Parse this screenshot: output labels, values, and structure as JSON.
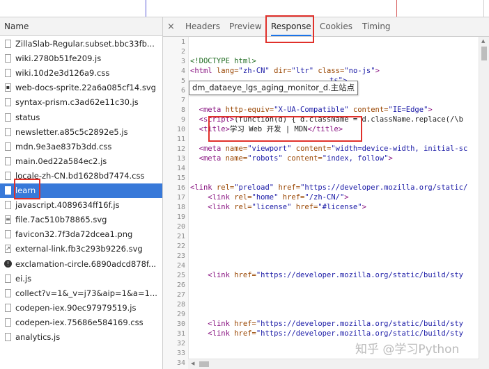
{
  "network": {
    "column_header": "Name",
    "requests": [
      {
        "name": "ZillaSlab-Regular.subset.bbc33fb...",
        "icon": "file-icon"
      },
      {
        "name": "wiki.2780b51fe209.js",
        "icon": "file-icon"
      },
      {
        "name": "wiki.10d2e3d126a9.css",
        "icon": "file-icon"
      },
      {
        "name": "web-docs-sprite.22a6a085cf14.svg",
        "icon": "sprite-icon"
      },
      {
        "name": "syntax-prism.c3ad62e11c30.js",
        "icon": "file-icon"
      },
      {
        "name": "status",
        "icon": "file-icon"
      },
      {
        "name": "newsletter.a85c5c2892e5.js",
        "icon": "file-icon"
      },
      {
        "name": "mdn.9e3ae837b3dd.css",
        "icon": "file-icon"
      },
      {
        "name": "main.0ed22a584ec2.js",
        "icon": "file-icon"
      },
      {
        "name": "locale-zh-CN.bd1628bd7474.css",
        "icon": "file-icon"
      },
      {
        "name": "learn",
        "icon": "file-icon",
        "selected": true
      },
      {
        "name": "javascript.4089634ff16f.js",
        "icon": "file-icon"
      },
      {
        "name": "file.7ac510b78865.svg",
        "icon": "document-icon"
      },
      {
        "name": "favicon32.7f3da72dcea1.png",
        "icon": "file-icon"
      },
      {
        "name": "external-link.fb3c293b9226.svg",
        "icon": "external-link-icon"
      },
      {
        "name": "exclamation-circle.6890adcd878f...",
        "icon": "exclamation-icon"
      },
      {
        "name": "ei.js",
        "icon": "file-icon"
      },
      {
        "name": "collect?v=1&_v=j73&aip=1&a=1...",
        "icon": "file-icon"
      },
      {
        "name": "codepen-iex.90ec97979519.js",
        "icon": "file-icon"
      },
      {
        "name": "codepen-iex.75686e584169.css",
        "icon": "file-icon"
      },
      {
        "name": "analytics.js",
        "icon": "file-icon"
      }
    ]
  },
  "tabs": {
    "close": "×",
    "items": [
      "Headers",
      "Preview",
      "Response",
      "Cookies",
      "Timing"
    ],
    "active": "Response"
  },
  "response": {
    "line_numbers": [
      "1",
      "2",
      "3",
      "4",
      "5",
      "6",
      "7",
      "8",
      "9",
      "10",
      "11",
      "12",
      "13",
      "14",
      "15",
      "16",
      "17",
      "18",
      "19",
      "20",
      "21",
      "22",
      "23",
      "24",
      "25",
      "26",
      "27",
      "28",
      "29",
      "30",
      "31",
      "32",
      "33",
      "34"
    ],
    "lines": {
      "l2_open": "<!DOCTYPE html>",
      "l3_html_tag": "<html",
      "l3_lang_attr": " lang=",
      "l3_lang_val": "\"zh-CN\"",
      "l3_dir_attr": " dir=",
      "l3_dir_val": "\"ltr\"",
      "l3_class_attr": " class=",
      "l3_class_val": "\"no-js\"",
      "l3_close": ">",
      "l4_tail": "ts\">",
      "l7_meta": "<meta",
      "l7_http_attr": " http-equiv=",
      "l7_http_val": "\"X-UA-Compatible\"",
      "l7_content_attr": " content=",
      "l7_content_val": "\"IE=Edge\"",
      "l7_close": ">",
      "l8_script": "<script>",
      "l8_code": "(function(d) { d.className = d.className.replace(/\\b",
      "l9_title_open": "<title>",
      "l9_title_text": "学习 Web 开发 | MDN",
      "l9_title_close": "</title>",
      "l11_meta": "<meta",
      "l11_name_attr": " name=",
      "l11_name_val": "\"viewport\"",
      "l11_content_attr": " content=",
      "l11_content_val": "\"width=device-width, initial-sc",
      "l12_meta": "<meta",
      "l12_name_attr": " name=",
      "l12_name_val": "\"robots\"",
      "l12_content_attr": " content=",
      "l12_content_val": "\"index, follow\"",
      "l12_close": ">",
      "l15_link": "<link",
      "l15_rel_attr": " rel=",
      "l15_rel_val": "\"preload\"",
      "l15_href_attr": " href=",
      "l15_href_val": "\"https://developer.mozilla.org/static/",
      "l16_link": "<link",
      "l16_rel_attr": " rel=",
      "l16_rel_val": "\"home\"",
      "l16_href_attr": " href=",
      "l16_href_val": "\"/zh-CN/\"",
      "l16_close": ">",
      "l17_link": "<link",
      "l17_rel_attr": " rel=",
      "l17_rel_val": "\"license\"",
      "l17_href_attr": " href=",
      "l17_href_val": "\"#license\"",
      "l17_close": ">",
      "l25_link": "<link",
      "l25_href_attr": " href=",
      "l25_href_val": "\"https://developer.mozilla.org/static/build/sty",
      "l30_link": "<link",
      "l30_href_attr": " href=",
      "l30_href_val": "\"https://developer.mozilla.org/static/build/sty",
      "l31_link": "<link",
      "l31_href_attr": " href=",
      "l31_href_val": "\"https://developer.mozilla.org/static/build/sty"
    }
  },
  "tooltip": "dm_dataeye_lgs_aging_monitor_d.主站点",
  "watermark": "知乎 @学习Python",
  "colors": {
    "tag": "#881280",
    "attr": "#994500",
    "value": "#1a1aa6",
    "selected_row": "#3879d9",
    "highlight_box": "#e0302a"
  }
}
